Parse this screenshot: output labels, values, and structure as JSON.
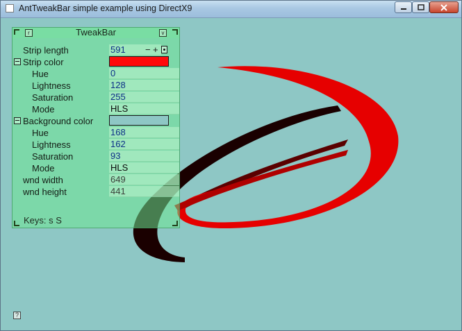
{
  "window": {
    "title": "AntTweakBar simple example using DirectX9"
  },
  "tweakbar": {
    "title": "TweakBar",
    "header_button_left": "r",
    "header_button_right": "v",
    "rows": [
      {
        "label": "Strip length",
        "value": "591",
        "kind": "stepper"
      },
      {
        "label": "Strip color",
        "kind": "group-color",
        "color": "#ff0a0a"
      },
      {
        "label": "Hue",
        "value": "0",
        "kind": "edit"
      },
      {
        "label": "Lightness",
        "value": "128",
        "kind": "edit"
      },
      {
        "label": "Saturation",
        "value": "255",
        "kind": "edit"
      },
      {
        "label": "Mode",
        "value": "HLS",
        "kind": "enum"
      },
      {
        "label": "Background color",
        "kind": "group-color",
        "color": "#8ec7c5"
      },
      {
        "label": "Hue",
        "value": "168",
        "kind": "edit"
      },
      {
        "label": "Lightness",
        "value": "162",
        "kind": "edit"
      },
      {
        "label": "Saturation",
        "value": "93",
        "kind": "edit"
      },
      {
        "label": "Mode",
        "value": "HLS",
        "kind": "enum"
      },
      {
        "label": "wnd width",
        "value": "649",
        "kind": "readonly"
      },
      {
        "label": "wnd height",
        "value": "441",
        "kind": "readonly"
      }
    ],
    "stepper_minus": "−",
    "stepper_plus": "+",
    "keys_text": "Keys: s  S"
  },
  "help_icon_label": "?",
  "colors": {
    "background": "#8ec7c5",
    "strip_front": "#e60000",
    "strip_back": "#1a0000"
  }
}
